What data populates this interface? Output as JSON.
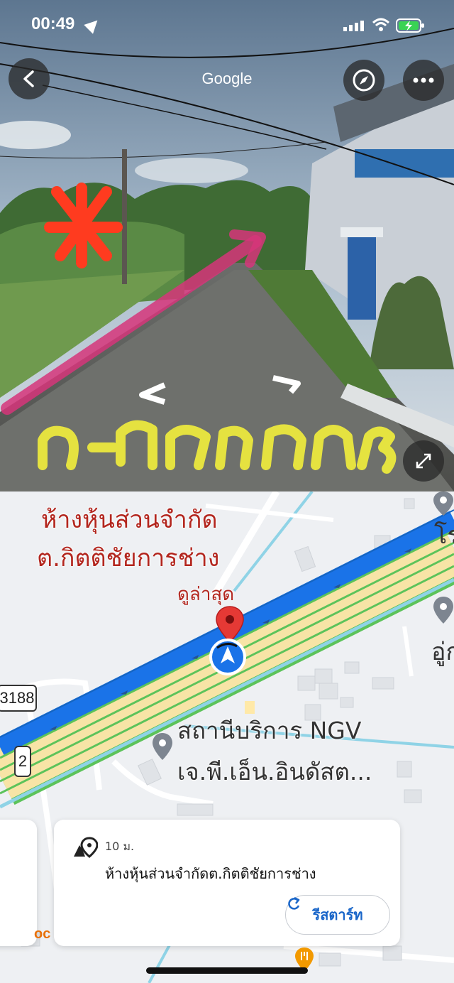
{
  "status_bar": {
    "time": "00:49"
  },
  "street_view": {
    "provider": "Google",
    "handwritten_caption": "ถ.มิตรภาพ"
  },
  "map": {
    "poi_title_line1": "ห้างหุ้นส่วนจำกัด",
    "poi_title_line2": "ต.กิตติชัยการช่าง",
    "poi_subtitle": "ดูล่าสุด",
    "ngv_line1": "สถานีบริการ NGV",
    "ngv_line2": "เจ.พี.เอ็น.อินดัสต...",
    "right_label1": "โร",
    "right_label2": "อู่ก",
    "route_shield1": "3188",
    "route_shield2": "2",
    "left_card_glyph": "oc"
  },
  "info_card": {
    "distance": "10 ม.",
    "place_name": "ห้างหุ้นส่วนจำกัดต.กิตติชัยการช่าง",
    "restart_label": "รีสตาร์ท"
  },
  "colors": {
    "accent_blue": "#1a73e8",
    "red_title": "#b3261e",
    "pin_red": "#e53935"
  }
}
